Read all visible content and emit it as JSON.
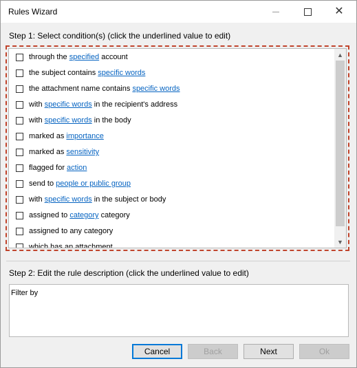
{
  "window": {
    "title": "Rules Wizard"
  },
  "step1": {
    "label": "Step 1: Select condition(s) (click the underlined value to edit)"
  },
  "conditions": [
    {
      "pre": "through the ",
      "link": "specified",
      "post": " account"
    },
    {
      "pre": "the subject contains ",
      "link": "specific words",
      "post": ""
    },
    {
      "pre": "the attachment name contains ",
      "link": "specific words",
      "post": ""
    },
    {
      "pre": "with ",
      "link": "specific words",
      "post": " in the recipient's address"
    },
    {
      "pre": "with ",
      "link": "specific words",
      "post": " in the body"
    },
    {
      "pre": "marked as ",
      "link": "importance",
      "post": ""
    },
    {
      "pre": "marked as ",
      "link": "sensitivity",
      "post": ""
    },
    {
      "pre": "flagged for ",
      "link": "action",
      "post": ""
    },
    {
      "pre": "send to ",
      "link": "people or public group",
      "post": ""
    },
    {
      "pre": "with ",
      "link": "specific words",
      "post": " in the subject or body"
    },
    {
      "pre": "assigned to ",
      "link": "category",
      "post": " category"
    },
    {
      "pre": "assigned to any category",
      "link": "",
      "post": ""
    },
    {
      "pre": "which has an attachment",
      "link": "",
      "post": ""
    }
  ],
  "step2": {
    "label": "Step 2: Edit the rule description (click the underlined value to edit)"
  },
  "description": {
    "text": "Filter by"
  },
  "buttons": {
    "cancel": "Cancel",
    "back": "Back",
    "next": "Next",
    "ok": "Ok"
  },
  "colors": {
    "highlight_border": "#c0432b",
    "link": "#0563c1",
    "default_button": "#0078d7"
  }
}
